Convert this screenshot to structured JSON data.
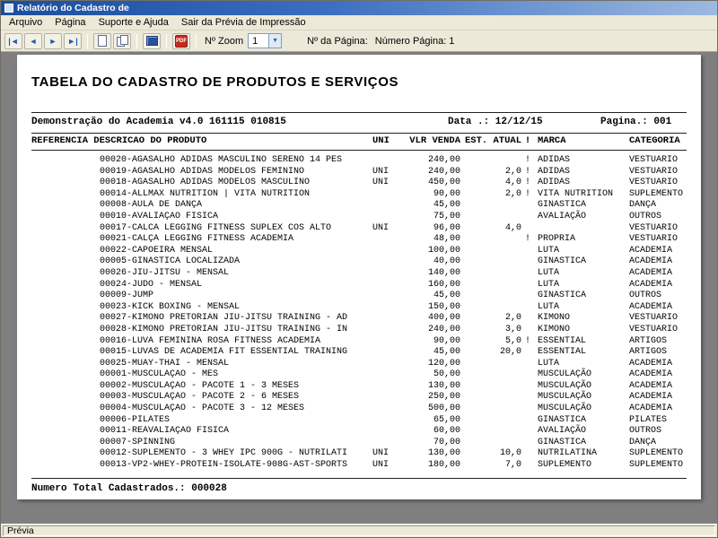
{
  "window": {
    "title": "Relatório do Cadastro de",
    "menu": {
      "items": [
        "Arquivo",
        "Página",
        "Suporte e Ajuda",
        "Sair da Prévia de Impressão"
      ]
    },
    "statusbar": {
      "text": "Prévia"
    }
  },
  "toolbar": {
    "nav": {
      "first": "|◄",
      "prev": "◄",
      "next": "►",
      "last": "►|"
    },
    "pdf_label": "PDF",
    "zoom_label": "Nº Zoom",
    "zoom_value": "1",
    "page_field_label": "Nº da Página:",
    "page_field_value": "Número Página: 1",
    "accent_color": "#1b5cb4",
    "pdf_color": "#c92a1d"
  },
  "report": {
    "title": "TABELA DO CADASTRO DE PRODUTOS E SERVIÇOS",
    "app_line": "Demonstração do Academia v4.0 161115 010815",
    "date": "Data .: 12/12/15",
    "page": "Pagina.: 001",
    "header": {
      "ref_desc": "REFERENCIA DESCRICAO DO PRODUTO",
      "uni": "UNI",
      "vlr": "VLR VENDA",
      "est": "EST. ATUAL",
      "flag": "!",
      "marca": "MARCA",
      "cat": "CATEGORIA"
    },
    "rows": [
      {
        "desc": "00020-AGASALHO ADIDAS MASCULINO SERENO 14 PES",
        "uni": "",
        "vlr": "240,00",
        "est": "",
        "flag": "!",
        "marca": "ADIDAS",
        "cat": "VESTUARIO"
      },
      {
        "desc": "00019-AGASALHO ADIDAS MODELOS FEMININO",
        "uni": "UNI",
        "vlr": "240,00",
        "est": "2,0",
        "flag": "!",
        "marca": "ADIDAS",
        "cat": "VESTUARIO"
      },
      {
        "desc": "00018-AGASALHO ADIDAS MODELOS MASCULINO",
        "uni": "UNI",
        "vlr": "450,00",
        "est": "4,0",
        "flag": "!",
        "marca": "ADIDAS",
        "cat": "VESTUARIO"
      },
      {
        "desc": "00014-ALLMAX NUTRITION | VITA NUTRITION",
        "uni": "",
        "vlr": "90,00",
        "est": "2,0",
        "flag": "!",
        "marca": "VITA NUTRITION",
        "cat": "SUPLEMENTO"
      },
      {
        "desc": "00008-AULA DE DANÇA",
        "uni": "",
        "vlr": "45,00",
        "est": "",
        "flag": "",
        "marca": "GINASTICA",
        "cat": "DANÇA"
      },
      {
        "desc": "00010-AVALIAÇÃO FISICA",
        "uni": "",
        "vlr": "75,00",
        "est": "",
        "flag": "",
        "marca": "AVALIAÇÃO",
        "cat": "OUTROS"
      },
      {
        "desc": "00017-CALCA LEGGING FITNESS SUPLEX COS ALTO",
        "uni": "UNI",
        "vlr": "96,00",
        "est": "4,0",
        "flag": "",
        "marca": "",
        "cat": "VESTUARIO"
      },
      {
        "desc": "00021-CALÇA LEGGING FITNESS ACADEMIA",
        "uni": "",
        "vlr": "48,00",
        "est": "",
        "flag": "!",
        "marca": "PROPRIA",
        "cat": "VESTUARIO"
      },
      {
        "desc": "00022-CAPOEIRA MENSAL",
        "uni": "",
        "vlr": "100,00",
        "est": "",
        "flag": "",
        "marca": "LUTA",
        "cat": "ACADEMIA"
      },
      {
        "desc": "00005-GINÁSTICA LOCALIZADA",
        "uni": "",
        "vlr": "40,00",
        "est": "",
        "flag": "",
        "marca": "GINASTICA",
        "cat": "ACADEMIA"
      },
      {
        "desc": "00026-JIU-JITSU - MENSAL",
        "uni": "",
        "vlr": "140,00",
        "est": "",
        "flag": "",
        "marca": "LUTA",
        "cat": "ACADEMIA"
      },
      {
        "desc": "00024-JUDÔ - MENSAL",
        "uni": "",
        "vlr": "160,00",
        "est": "",
        "flag": "",
        "marca": "LUTA",
        "cat": "ACADEMIA"
      },
      {
        "desc": "00009-JUMP",
        "uni": "",
        "vlr": "45,00",
        "est": "",
        "flag": "",
        "marca": "GINASTICA",
        "cat": "OUTROS"
      },
      {
        "desc": "00023-KICK BOXING - MENSAL",
        "uni": "",
        "vlr": "150,00",
        "est": "",
        "flag": "",
        "marca": "LUTA",
        "cat": "ACADEMIA"
      },
      {
        "desc": "00027-KIMONO PRETORIAN JIU-JÍTSU TRAINING - AD",
        "uni": "",
        "vlr": "400,00",
        "est": "2,0",
        "flag": "",
        "marca": "KIMONO",
        "cat": "VESTUARIO"
      },
      {
        "desc": "00028-KIMONO PRETORIAN JIU-JÍTSU TRAINING - IN",
        "uni": "",
        "vlr": "240,00",
        "est": "3,0",
        "flag": "",
        "marca": "KIMONO",
        "cat": "VESTUARIO"
      },
      {
        "desc": "00016-LUVA FEMININA ROSA FITNESS ACADEMIA",
        "uni": "",
        "vlr": "90,00",
        "est": "5,0",
        "flag": "!",
        "marca": "ESSENTIAL",
        "cat": "ARTIGOS"
      },
      {
        "desc": "00015-LUVAS DE ACADEMIA FIT ESSENTIAL TRAINING",
        "uni": "",
        "vlr": "45,00",
        "est": "20,0",
        "flag": "",
        "marca": "ESSENTIAL",
        "cat": "ARTIGOS"
      },
      {
        "desc": "00025-MUAY-THAI - MENSAL",
        "uni": "",
        "vlr": "120,00",
        "est": "",
        "flag": "",
        "marca": "LUTA",
        "cat": "ACADEMIA"
      },
      {
        "desc": "00001-MUSCULAÇÃO - MES",
        "uni": "",
        "vlr": "50,00",
        "est": "",
        "flag": "",
        "marca": "MUSCULAÇÃO",
        "cat": "ACADEMIA"
      },
      {
        "desc": "00002-MUSCULAÇÃO - PACOTE 1 - 3 MESES",
        "uni": "",
        "vlr": "130,00",
        "est": "",
        "flag": "",
        "marca": "MUSCULAÇÃO",
        "cat": "ACADEMIA"
      },
      {
        "desc": "00003-MUSCULAÇÃO - PACOTE 2 - 6 MESES",
        "uni": "",
        "vlr": "250,00",
        "est": "",
        "flag": "",
        "marca": "MUSCULAÇÃO",
        "cat": "ACADEMIA"
      },
      {
        "desc": "00004-MUSCULAÇÃO - PACOTE 3 - 12 MESES",
        "uni": "",
        "vlr": "500,00",
        "est": "",
        "flag": "",
        "marca": "MUSCULAÇÃO",
        "cat": "ACADEMIA"
      },
      {
        "desc": "00006-PILATES",
        "uni": "",
        "vlr": "65,00",
        "est": "",
        "flag": "",
        "marca": "GINASTICA",
        "cat": "PILATES"
      },
      {
        "desc": "00011-REAVALIAÇÃO FISICA",
        "uni": "",
        "vlr": "60,00",
        "est": "",
        "flag": "",
        "marca": "AVALIAÇÃO",
        "cat": "OUTROS"
      },
      {
        "desc": "00007-SPINNING",
        "uni": "",
        "vlr": "70,00",
        "est": "",
        "flag": "",
        "marca": "GINASTICA",
        "cat": "DANÇA"
      },
      {
        "desc": "00012-SUPLEMENTO - 3 WHEY IPC 900G - NUTRILATI",
        "uni": "UNI",
        "vlr": "130,00",
        "est": "10,0",
        "flag": "",
        "marca": "NUTRILATINA",
        "cat": "SUPLEMENTO"
      },
      {
        "desc": "00013-VP2-WHEY-PROTEIN-ISOLATE-908G-AST-SPORTS",
        "uni": "UNI",
        "vlr": "180,00",
        "est": "7,0",
        "flag": "",
        "marca": "SUPLEMENTO",
        "cat": "SUPLEMENTO"
      }
    ],
    "total": "Numero Total Cadastrados.: 000028"
  }
}
